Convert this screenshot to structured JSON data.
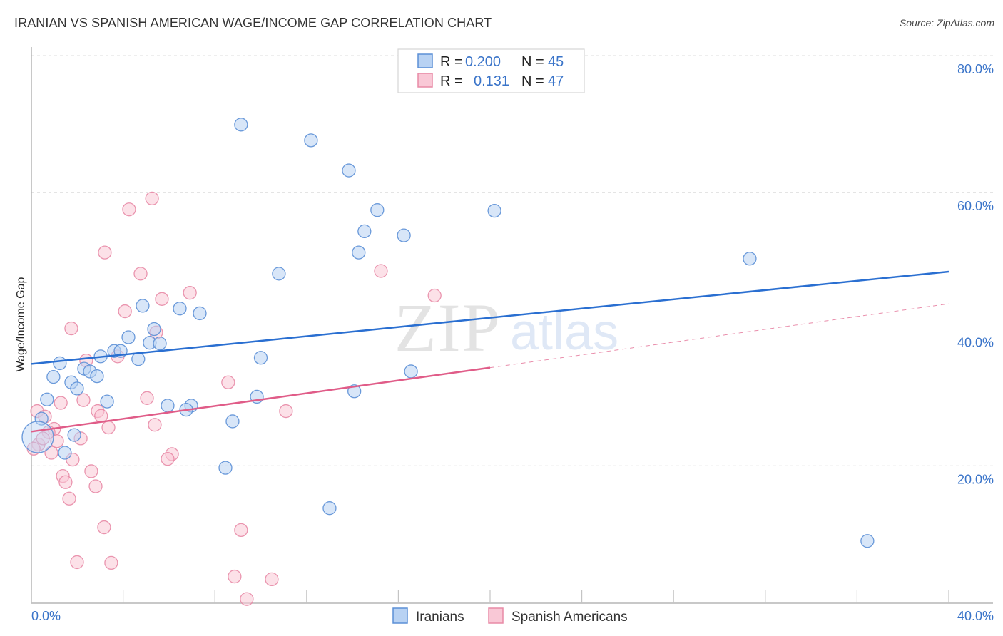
{
  "header": {
    "title": "IRANIAN VS SPANISH AMERICAN WAGE/INCOME GAP CORRELATION CHART",
    "source": "Source: ZipAtlas.com"
  },
  "watermark": {
    "zip": "ZIP",
    "atlas": "atlas"
  },
  "colors": {
    "iranians_fill": "#b8d2f3",
    "iranians_stroke": "#5b8fd6",
    "iranians_line": "#2a6fd1",
    "spanish_fill": "#f9c8d6",
    "spanish_stroke": "#e88aa6",
    "spanish_line": "#e05c88",
    "tick_text": "#3a74c9"
  },
  "stats_legend": [
    {
      "swatch": "iranians",
      "r_label": "R =",
      "r_value": "0.200",
      "n_label": "N =",
      "n_value": "45"
    },
    {
      "swatch": "spanish",
      "r_label": "R =",
      "r_value": "0.131",
      "n_label": "N =",
      "n_value": "47"
    }
  ],
  "chart_data": {
    "type": "scatter",
    "title": "IRANIAN VS SPANISH AMERICAN WAGE/INCOME GAP CORRELATION CHART",
    "xlabel": "",
    "ylabel": "Wage/Income Gap",
    "xlim": [
      0,
      40
    ],
    "ylim": [
      0,
      82
    ],
    "x_ticks": [
      0,
      4,
      8,
      12,
      16,
      20,
      24,
      28,
      32,
      36,
      40
    ],
    "x_tick_labels": [
      {
        "value": 0,
        "label": "0.0%"
      },
      {
        "value": 40,
        "label": "40.0%"
      }
    ],
    "y_ticks": [
      {
        "value": 20,
        "label": "20.0%"
      },
      {
        "value": 40,
        "label": "40.0%"
      },
      {
        "value": 60,
        "label": "60.0%"
      },
      {
        "value": 80,
        "label": "80.0%"
      }
    ],
    "grid": "horizontal dashed",
    "legend_position": "bottom-center",
    "series": [
      {
        "name": "Iranians",
        "key": "iranians",
        "R": 0.2,
        "N": 45,
        "trend": {
          "x": [
            0,
            40
          ],
          "y": [
            34.9,
            48.4
          ],
          "solid_to": 40
        },
        "points": [
          [
            9.14,
            69.9
          ],
          [
            12.19,
            67.6
          ],
          [
            13.84,
            63.2
          ],
          [
            15.08,
            57.4
          ],
          [
            20.19,
            57.3
          ],
          [
            14.52,
            54.3
          ],
          [
            16.24,
            53.7
          ],
          [
            14.27,
            51.2
          ],
          [
            31.32,
            50.3
          ],
          [
            10.79,
            48.1
          ],
          [
            4.85,
            43.4
          ],
          [
            6.47,
            43.0
          ],
          [
            7.34,
            42.3
          ],
          [
            5.35,
            40.0
          ],
          [
            4.23,
            38.8
          ],
          [
            5.16,
            38.0
          ],
          [
            5.6,
            37.9
          ],
          [
            3.61,
            36.8
          ],
          [
            3.89,
            36.8
          ],
          [
            3.02,
            36.0
          ],
          [
            4.66,
            35.6
          ],
          [
            10.0,
            35.8
          ],
          [
            1.24,
            35.0
          ],
          [
            2.3,
            34.2
          ],
          [
            2.55,
            33.8
          ],
          [
            2.86,
            33.1
          ],
          [
            0.96,
            33.0
          ],
          [
            16.55,
            33.8
          ],
          [
            1.74,
            32.2
          ],
          [
            1.99,
            31.3
          ],
          [
            14.08,
            30.9
          ],
          [
            0.68,
            29.7
          ],
          [
            3.3,
            29.4
          ],
          [
            9.83,
            30.1
          ],
          [
            5.94,
            28.8
          ],
          [
            6.97,
            28.8
          ],
          [
            6.75,
            28.2
          ],
          [
            8.77,
            26.5
          ],
          [
            0.44,
            26.9
          ],
          [
            0.28,
            24.2
          ],
          [
            1.46,
            21.9
          ],
          [
            8.46,
            19.7
          ],
          [
            13.0,
            13.8
          ],
          [
            36.45,
            9.0
          ],
          [
            1.87,
            24.5
          ]
        ],
        "large_point_index": 39
      },
      {
        "name": "Spanish Americans",
        "key": "spanish",
        "R": 0.131,
        "N": 47,
        "trend": {
          "x": [
            0,
            40
          ],
          "y": [
            25.0,
            43.7
          ],
          "solid_to": 20
        },
        "points": [
          [
            5.26,
            59.1
          ],
          [
            4.26,
            57.5
          ],
          [
            3.2,
            51.2
          ],
          [
            4.76,
            48.1
          ],
          [
            15.24,
            48.5
          ],
          [
            6.91,
            45.3
          ],
          [
            5.69,
            44.4
          ],
          [
            17.58,
            44.9
          ],
          [
            4.08,
            42.6
          ],
          [
            1.74,
            40.1
          ],
          [
            5.44,
            39.5
          ],
          [
            3.76,
            36.0
          ],
          [
            2.39,
            35.4
          ],
          [
            8.58,
            32.2
          ],
          [
            5.04,
            29.9
          ],
          [
            2.27,
            29.6
          ],
          [
            1.28,
            29.2
          ],
          [
            11.1,
            28.0
          ],
          [
            2.89,
            28.0
          ],
          [
            3.04,
            27.3
          ],
          [
            0.25,
            28.0
          ],
          [
            0.59,
            27.2
          ],
          [
            5.38,
            26.0
          ],
          [
            3.36,
            25.6
          ],
          [
            0.99,
            25.4
          ],
          [
            0.75,
            24.9
          ],
          [
            2.15,
            24.0
          ],
          [
            1.12,
            23.6
          ],
          [
            0.31,
            23.1
          ],
          [
            6.13,
            21.7
          ],
          [
            5.94,
            21.0
          ],
          [
            0.87,
            21.9
          ],
          [
            1.8,
            20.9
          ],
          [
            2.61,
            19.2
          ],
          [
            1.37,
            18.5
          ],
          [
            1.49,
            17.6
          ],
          [
            2.8,
            17.0
          ],
          [
            1.65,
            15.2
          ],
          [
            3.17,
            11.0
          ],
          [
            9.14,
            10.6
          ],
          [
            1.99,
            5.9
          ],
          [
            3.48,
            5.8
          ],
          [
            8.86,
            3.8
          ],
          [
            10.48,
            3.4
          ],
          [
            9.39,
            0.5
          ],
          [
            0.5,
            24.0
          ],
          [
            0.1,
            22.5
          ]
        ]
      }
    ]
  },
  "bottom_legend": [
    {
      "key": "iranians",
      "label": "Iranians"
    },
    {
      "key": "spanish",
      "label": "Spanish Americans"
    }
  ]
}
